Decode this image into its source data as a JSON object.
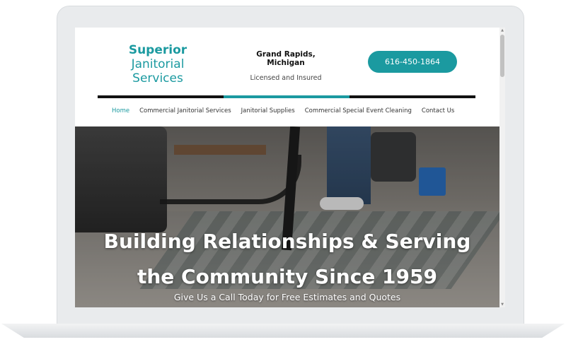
{
  "site": {
    "logo": {
      "line1": "Superior",
      "line2": "Janitorial",
      "line3": "Services"
    },
    "header": {
      "city": "Grand Rapids, Michigan",
      "license": "Licensed and Insured",
      "phone": "616-450-1864"
    },
    "nav": {
      "items": [
        {
          "label": "Home",
          "active": true
        },
        {
          "label": "Commercial Janitorial Services",
          "active": false
        },
        {
          "label": "Janitorial Supplies",
          "active": false
        },
        {
          "label": "Commercial Special Event Cleaning",
          "active": false
        },
        {
          "label": "Contact Us",
          "active": false
        }
      ]
    },
    "hero": {
      "title_line1": "Building Relationships & Serving",
      "title_line2": "the Community Since 1959",
      "subtitle": "Give Us a Call Today for Free Estimates and Quotes"
    },
    "colors": {
      "accent": "#1b9aa0",
      "dark": "#111111"
    }
  }
}
